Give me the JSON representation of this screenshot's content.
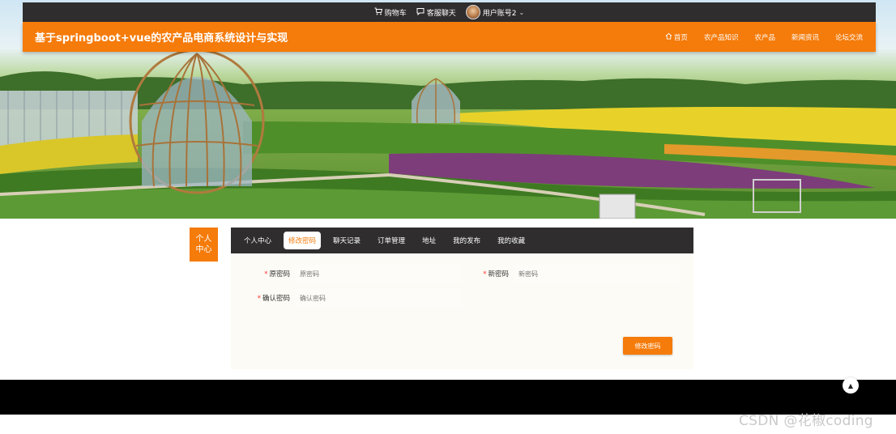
{
  "topbar": {
    "cart_label": "购物车",
    "chat_label": "客服聊天",
    "user_label": "用户账号2"
  },
  "header": {
    "title": "基于springboot+vue的农产品电商系统设计与实现",
    "nav": [
      {
        "label": "首页",
        "icon": "home-icon"
      },
      {
        "label": "农产品知识"
      },
      {
        "label": "农产品"
      },
      {
        "label": "新闻资讯"
      },
      {
        "label": "论坛交流"
      }
    ]
  },
  "center": {
    "side_label": "个人中心",
    "tabs": [
      {
        "label": "个人中心",
        "active": false
      },
      {
        "label": "修改密码",
        "active": true
      },
      {
        "label": "聊天记录",
        "active": false
      },
      {
        "label": "订单管理",
        "active": false
      },
      {
        "label": "地址",
        "active": false
      },
      {
        "label": "我的发布",
        "active": false
      },
      {
        "label": "我的收藏",
        "active": false
      }
    ]
  },
  "form": {
    "old_password": {
      "label": "原密码",
      "placeholder": "原密码"
    },
    "new_password": {
      "label": "新密码",
      "placeholder": "新密码"
    },
    "confirm_password": {
      "label": "确认密码",
      "placeholder": "确认密码"
    },
    "submit_label": "修改密码"
  },
  "watermark": "CSDN @花椒coding",
  "colors": {
    "accent": "#f57b0a",
    "dark_bar": "#2f2d2e",
    "footer": "#000000"
  }
}
